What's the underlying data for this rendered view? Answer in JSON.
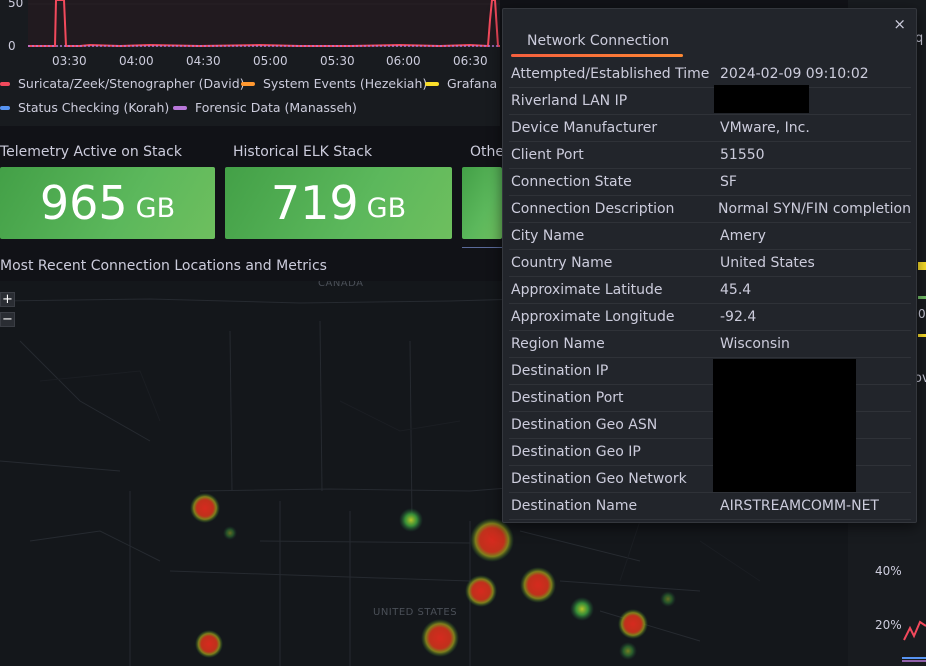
{
  "timeseries": {
    "y_ticks": [
      "50",
      "0"
    ],
    "x_ticks": [
      "03:30",
      "04:00",
      "04:30",
      "05:00",
      "05:30",
      "06:00",
      "06:30"
    ],
    "legend": [
      {
        "label": "Suricata/Zeek/Stenographer (David)",
        "color": "#f2495c"
      },
      {
        "label": "System Events (Hezekiah)",
        "color": "#ff9830"
      },
      {
        "label": "Grafana (",
        "color": "#fade2a"
      },
      {
        "label": "Status Checking (Korah)",
        "color": "#5794f2"
      },
      {
        "label": "Forensic Data (Manasseh)",
        "color": "#b877d9"
      }
    ]
  },
  "stats": [
    {
      "title": "Telemetry Active on Stack",
      "value": "965",
      "unit": "GB"
    },
    {
      "title": "Historical ELK Stack",
      "value": "719",
      "unit": "GB"
    },
    {
      "title": "Othe",
      "value": "",
      "unit": ""
    }
  ],
  "map": {
    "title": "Most Recent Connection Locations and Metrics",
    "zoom_in": "+",
    "zoom_out": "−",
    "labels": {
      "canada": "CANADA",
      "united_states": "UNITED STATES"
    }
  },
  "right_strip": {
    "pct_40": "40%",
    "pct_20": "20%",
    "partial_q": "q",
    "partial_ov": "ov",
    "partial_0": "0"
  },
  "tooltip": {
    "close": "×",
    "tab": "Network Connection",
    "rows": [
      {
        "key": "Attempted/Established Time",
        "value": "2024-02-09 09:10:02"
      },
      {
        "key": "Riverland LAN IP",
        "value": ""
      },
      {
        "key": "Device Manufacturer",
        "value": "VMware, Inc."
      },
      {
        "key": "Client Port",
        "value": "51550"
      },
      {
        "key": "Connection State",
        "value": "SF"
      },
      {
        "key": "Connection Description",
        "value": "Normal SYN/FIN completion"
      },
      {
        "key": "City Name",
        "value": "Amery"
      },
      {
        "key": "Country Name",
        "value": "United States"
      },
      {
        "key": "Approximate Latitude",
        "value": "45.4"
      },
      {
        "key": "Approximate Longitude",
        "value": "-92.4"
      },
      {
        "key": "Region Name",
        "value": "Wisconsin"
      },
      {
        "key": "Destination IP",
        "value": ""
      },
      {
        "key": "Destination Port",
        "value": ""
      },
      {
        "key": "Destination Geo ASN",
        "value": ""
      },
      {
        "key": "Destination Geo IP",
        "value": ""
      },
      {
        "key": "Destination Geo Network",
        "value": ""
      },
      {
        "key": "Destination Name",
        "value": "AIRSTREAMCOMM-NET"
      }
    ]
  }
}
